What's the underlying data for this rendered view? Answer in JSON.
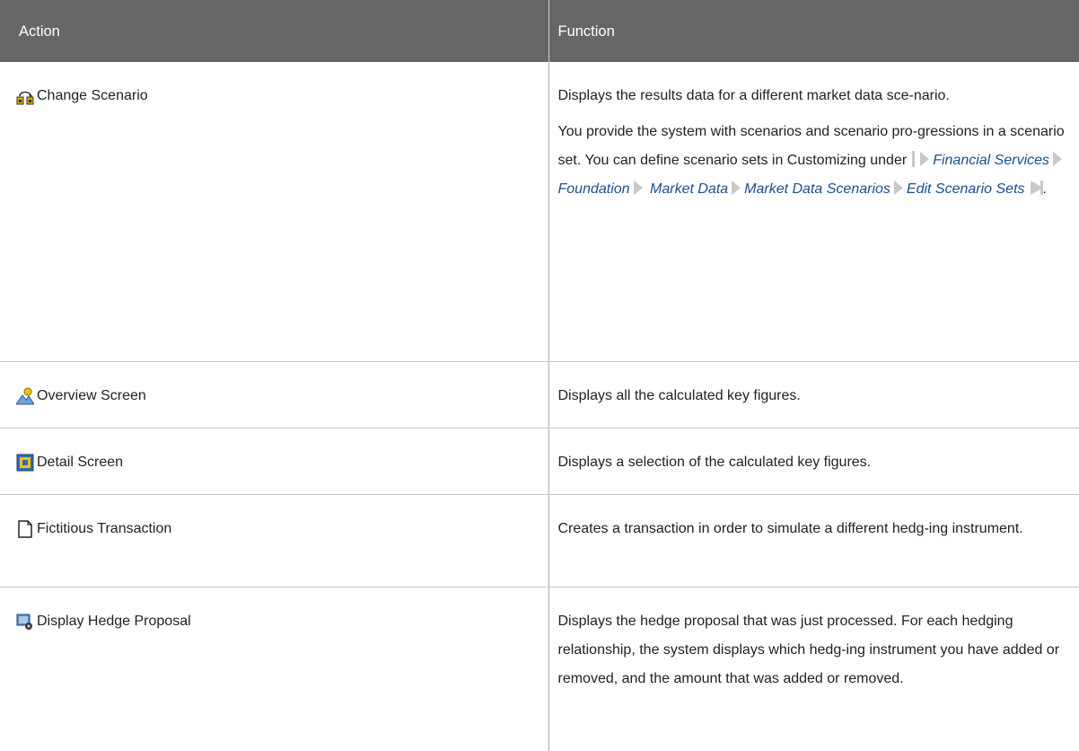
{
  "table": {
    "headers": {
      "action": "Action",
      "function": "Function"
    },
    "rows": [
      {
        "icon": "change-scenario-icon",
        "action": "Change Scenario",
        "function_p1": "Displays the results data for a different market data sce-nario.",
        "function_p2_intro": "You provide the system with scenarios and scenario pro-gressions in a scenario set. You can define scenario sets in Customizing under",
        "path": [
          "Financial Services",
          "Foundation",
          "Market Data",
          "Market Data Scenarios",
          "Edit Scenario Sets"
        ],
        "function_p2_end": "."
      },
      {
        "icon": "overview-screen-icon",
        "action": "Overview Screen",
        "function": "Displays all the calculated key figures."
      },
      {
        "icon": "detail-screen-icon",
        "action": "Detail Screen",
        "function": "Displays a selection of the calculated key figures."
      },
      {
        "icon": "document-icon",
        "action": "Fictitious Transaction",
        "function": "Creates a transaction in order to simulate a different hedg-ing instrument."
      },
      {
        "icon": "hedge-proposal-icon",
        "action": "Display Hedge Proposal",
        "function": "Displays the hedge proposal that was just processed. For each hedging relationship, the system displays which hedg-ing instrument you have added or removed, and the amount that was added or removed."
      }
    ]
  },
  "colors": {
    "header_bg": "#666666",
    "link": "#1a4f8c",
    "arrow": "#c8c8c8"
  }
}
